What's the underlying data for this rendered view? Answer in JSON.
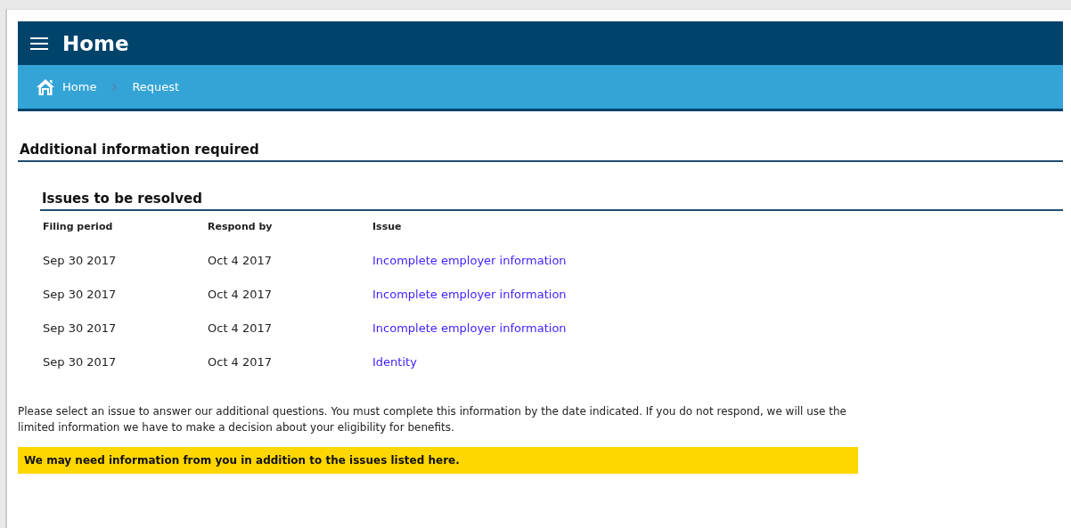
{
  "header": {
    "title": "Home"
  },
  "breadcrumb": [
    {
      "label": "Home",
      "kind": "home"
    },
    {
      "label": "Request",
      "kind": "page"
    }
  ],
  "section": {
    "title": "Additional information required"
  },
  "issues": {
    "title": "Issues to be resolved",
    "columns": [
      "Filing period",
      "Respond by",
      "Issue"
    ],
    "rows": [
      {
        "filing_period": "Sep 30 2017",
        "respond_by": "Oct 4 2017",
        "issue": "Incomplete employer information"
      },
      {
        "filing_period": "Sep 30 2017",
        "respond_by": "Oct 4 2017",
        "issue": "Incomplete employer information"
      },
      {
        "filing_period": "Sep 30 2017",
        "respond_by": "Oct 4 2017",
        "issue": "Incomplete employer information"
      },
      {
        "filing_period": "Sep 30 2017",
        "respond_by": "Oct 4 2017",
        "issue": "Identity"
      }
    ]
  },
  "note": "Please select an issue to answer our additional questions. You must complete this information by the date indicated. If you do not respond, we will use the limited information we have to make a decision about your eligibility for benefits.",
  "alert": "We may need information from you in addition to the issues listed here."
}
